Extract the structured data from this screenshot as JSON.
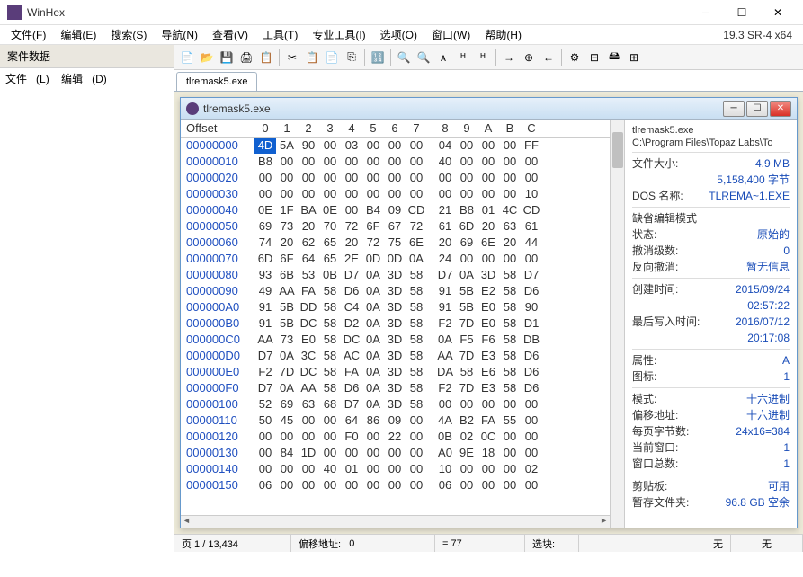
{
  "window": {
    "title": "WinHex"
  },
  "version": "19.3 SR-4 x64",
  "menu": [
    "文件(F)",
    "编辑(E)",
    "搜索(S)",
    "导航(N)",
    "查看(V)",
    "工具(T)",
    "专业工具(I)",
    "选项(O)",
    "窗口(W)",
    "帮助(H)"
  ],
  "sidebar": {
    "header": "案件数据",
    "menu": [
      {
        "label": "文件",
        "u": "L"
      },
      {
        "label": "编辑",
        "u": "D"
      }
    ]
  },
  "tab": {
    "label": "tlremask5.exe"
  },
  "child": {
    "title": "tlremask5.exe"
  },
  "hex": {
    "header_offset": "Offset",
    "cols": [
      "0",
      "1",
      "2",
      "3",
      "4",
      "5",
      "6",
      "7",
      "8",
      "9",
      "A",
      "B",
      "C"
    ],
    "rows": [
      {
        "o": "00000000",
        "b": [
          "4D",
          "5A",
          "90",
          "00",
          "03",
          "00",
          "00",
          "00",
          "04",
          "00",
          "00",
          "00",
          "FF"
        ]
      },
      {
        "o": "00000010",
        "b": [
          "B8",
          "00",
          "00",
          "00",
          "00",
          "00",
          "00",
          "00",
          "40",
          "00",
          "00",
          "00",
          "00"
        ]
      },
      {
        "o": "00000020",
        "b": [
          "00",
          "00",
          "00",
          "00",
          "00",
          "00",
          "00",
          "00",
          "00",
          "00",
          "00",
          "00",
          "00"
        ]
      },
      {
        "o": "00000030",
        "b": [
          "00",
          "00",
          "00",
          "00",
          "00",
          "00",
          "00",
          "00",
          "00",
          "00",
          "00",
          "00",
          "10"
        ]
      },
      {
        "o": "00000040",
        "b": [
          "0E",
          "1F",
          "BA",
          "0E",
          "00",
          "B4",
          "09",
          "CD",
          "21",
          "B8",
          "01",
          "4C",
          "CD"
        ]
      },
      {
        "o": "00000050",
        "b": [
          "69",
          "73",
          "20",
          "70",
          "72",
          "6F",
          "67",
          "72",
          "61",
          "6D",
          "20",
          "63",
          "61"
        ]
      },
      {
        "o": "00000060",
        "b": [
          "74",
          "20",
          "62",
          "65",
          "20",
          "72",
          "75",
          "6E",
          "20",
          "69",
          "6E",
          "20",
          "44"
        ]
      },
      {
        "o": "00000070",
        "b": [
          "6D",
          "6F",
          "64",
          "65",
          "2E",
          "0D",
          "0D",
          "0A",
          "24",
          "00",
          "00",
          "00",
          "00"
        ]
      },
      {
        "o": "00000080",
        "b": [
          "93",
          "6B",
          "53",
          "0B",
          "D7",
          "0A",
          "3D",
          "58",
          "D7",
          "0A",
          "3D",
          "58",
          "D7"
        ]
      },
      {
        "o": "00000090",
        "b": [
          "49",
          "AA",
          "FA",
          "58",
          "D6",
          "0A",
          "3D",
          "58",
          "91",
          "5B",
          "E2",
          "58",
          "D6"
        ]
      },
      {
        "o": "000000A0",
        "b": [
          "91",
          "5B",
          "DD",
          "58",
          "C4",
          "0A",
          "3D",
          "58",
          "91",
          "5B",
          "E0",
          "58",
          "90"
        ]
      },
      {
        "o": "000000B0",
        "b": [
          "91",
          "5B",
          "DC",
          "58",
          "D2",
          "0A",
          "3D",
          "58",
          "F2",
          "7D",
          "E0",
          "58",
          "D1"
        ]
      },
      {
        "o": "000000C0",
        "b": [
          "AA",
          "73",
          "E0",
          "58",
          "DC",
          "0A",
          "3D",
          "58",
          "0A",
          "F5",
          "F6",
          "58",
          "DB"
        ]
      },
      {
        "o": "000000D0",
        "b": [
          "D7",
          "0A",
          "3C",
          "58",
          "AC",
          "0A",
          "3D",
          "58",
          "AA",
          "7D",
          "E3",
          "58",
          "D6"
        ]
      },
      {
        "o": "000000E0",
        "b": [
          "F2",
          "7D",
          "DC",
          "58",
          "FA",
          "0A",
          "3D",
          "58",
          "DA",
          "58",
          "E6",
          "58",
          "D6"
        ]
      },
      {
        "o": "000000F0",
        "b": [
          "D7",
          "0A",
          "AA",
          "58",
          "D6",
          "0A",
          "3D",
          "58",
          "F2",
          "7D",
          "E3",
          "58",
          "D6"
        ]
      },
      {
        "o": "00000100",
        "b": [
          "52",
          "69",
          "63",
          "68",
          "D7",
          "0A",
          "3D",
          "58",
          "00",
          "00",
          "00",
          "00",
          "00"
        ]
      },
      {
        "o": "00000110",
        "b": [
          "50",
          "45",
          "00",
          "00",
          "64",
          "86",
          "09",
          "00",
          "4A",
          "B2",
          "FA",
          "55",
          "00"
        ]
      },
      {
        "o": "00000120",
        "b": [
          "00",
          "00",
          "00",
          "00",
          "F0",
          "00",
          "22",
          "00",
          "0B",
          "02",
          "0C",
          "00",
          "00"
        ]
      },
      {
        "o": "00000130",
        "b": [
          "00",
          "84",
          "1D",
          "00",
          "00",
          "00",
          "00",
          "00",
          "A0",
          "9E",
          "18",
          "00",
          "00"
        ]
      },
      {
        "o": "00000140",
        "b": [
          "00",
          "00",
          "00",
          "40",
          "01",
          "00",
          "00",
          "00",
          "10",
          "00",
          "00",
          "00",
          "02"
        ]
      },
      {
        "o": "00000150",
        "b": [
          "06",
          "00",
          "00",
          "00",
          "00",
          "00",
          "00",
          "00",
          "06",
          "00",
          "00",
          "00",
          "00"
        ]
      }
    ]
  },
  "info": {
    "filename": "tlremask5.exe",
    "path": "C:\\Program Files\\Topaz Labs\\To",
    "size_label": "文件大小:",
    "size": "4.9 MB",
    "size_bytes": "5,158,400 字节",
    "dos_label": "DOS 名称:",
    "dos": "TLREMA~1.EXE",
    "editmode_hdr": "缺省编辑模式",
    "state_label": "状态:",
    "state": "原始的",
    "undo_label": "撤消级数:",
    "undo": "0",
    "revundo_label": "反向撤消:",
    "revundo": "暂无信息",
    "created_label": "创建时间:",
    "created_date": "2015/09/24",
    "created_time": "02:57:22",
    "modified_label": "最后写入时间:",
    "modified_date": "2016/07/12",
    "modified_time": "20:17:08",
    "attr_label": "属性:",
    "attr": "A",
    "icons_label": "图标:",
    "icons": "1",
    "mode_label": "模式:",
    "mode": "十六进制",
    "offset_label": "偏移地址:",
    "offset": "十六进制",
    "bpr_label": "每页字节数:",
    "bpr": "24x16=384",
    "curwin_label": "当前窗口:",
    "curwin": "1",
    "totwin_label": "窗口总数:",
    "totwin": "1",
    "clip_label": "剪贴板:",
    "clip": "可用",
    "temp_label": "暂存文件夹:",
    "temp": "96.8 GB 空余"
  },
  "status": {
    "page": "页 1 / 13,434",
    "offset_label": "偏移地址:",
    "offset": "0",
    "value_label": "= 77",
    "sel_label": "选块:",
    "no1": "无",
    "no2": "无"
  },
  "toolbar_icons": [
    "📄",
    "📂",
    "💾",
    "🖨",
    "📋",
    "",
    "✂",
    "📋",
    "📄",
    "⎘",
    "",
    "🔢",
    "",
    "🔍",
    "🔍",
    "ᴀ",
    "ᴴ",
    "ᴴ",
    "",
    "→",
    "⊕",
    "←",
    "",
    "⚙",
    "⊟",
    "🖴",
    "⊞"
  ]
}
